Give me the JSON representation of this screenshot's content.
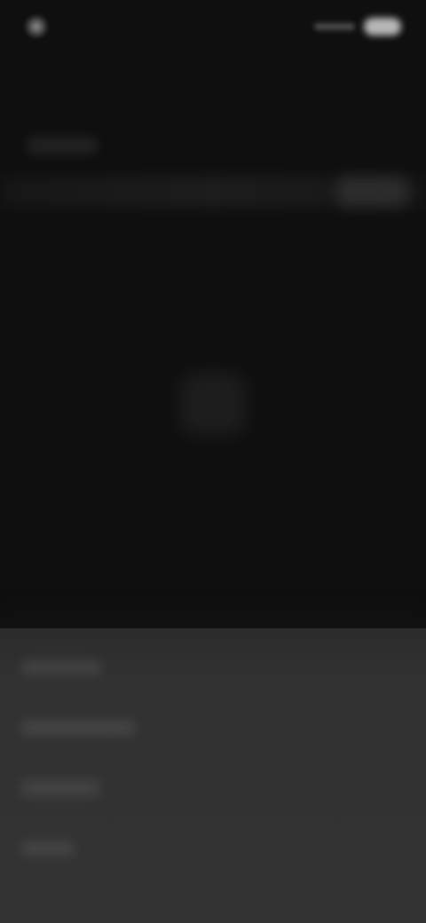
{
  "status_bar": {
    "time": "",
    "battery_icon": "battery-icon",
    "signal_icon": "signal-icon"
  },
  "header": {
    "title": ""
  },
  "center": {
    "icon": "placeholder-icon"
  },
  "sheet": {
    "items": [
      {
        "label": ""
      },
      {
        "label": ""
      },
      {
        "label": ""
      },
      {
        "label": ""
      }
    ]
  },
  "colors": {
    "background": "#0f0f0f",
    "sheet": "#333333"
  }
}
